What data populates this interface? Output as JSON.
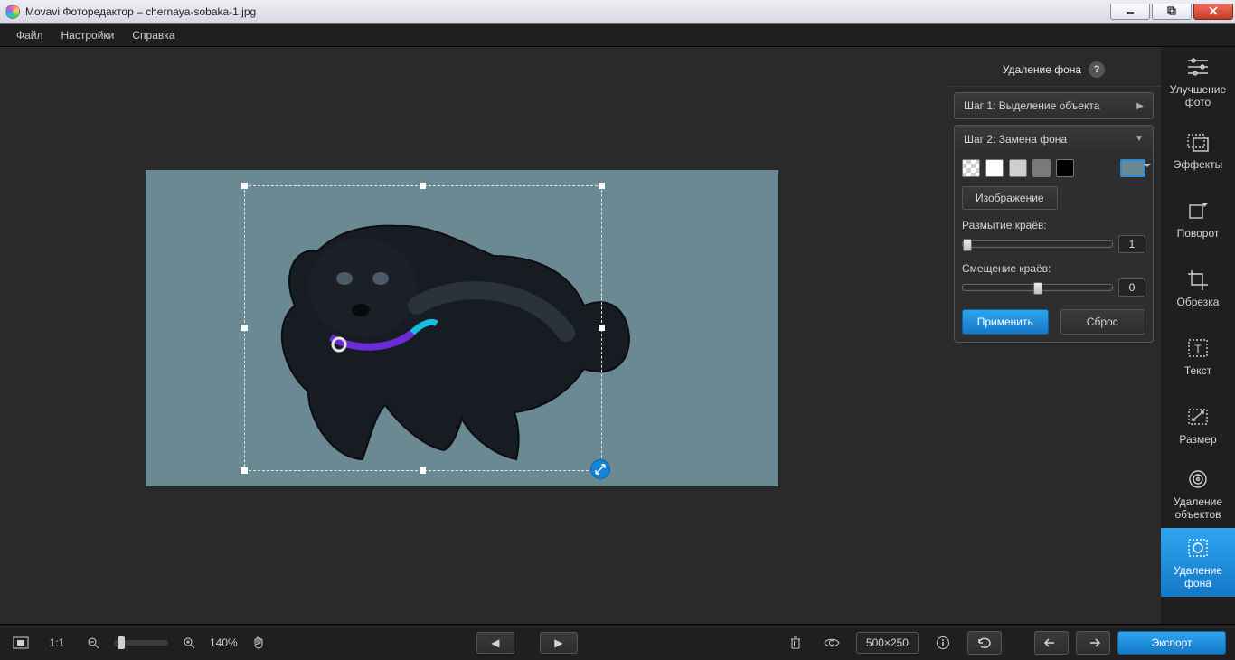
{
  "window": {
    "title": "Movavi Фоторедактор – chernaya-sobaka-1.jpg"
  },
  "menu": {
    "file": "Файл",
    "settings": "Настройки",
    "help": "Справка"
  },
  "panel": {
    "title": "Удаление фона",
    "step1": "Шаг 1: Выделение объекта",
    "step2": "Шаг 2: Замена фона",
    "image_btn": "Изображение",
    "blur_label": "Размытие краёв:",
    "blur_value": "1",
    "shift_label": "Смещение краёв:",
    "shift_value": "0",
    "apply": "Применить",
    "reset": "Сброс"
  },
  "tools": {
    "enhance": "Улучшение фото",
    "effects": "Эффекты",
    "rotate": "Поворот",
    "crop": "Обрезка",
    "text": "Текст",
    "resize": "Размер",
    "remove_obj": "Удаление объектов",
    "remove_bg": "Удаление фона"
  },
  "bottom": {
    "ratio": "1:1",
    "zoom": "140%",
    "dims": "500×250",
    "export": "Экспорт"
  }
}
